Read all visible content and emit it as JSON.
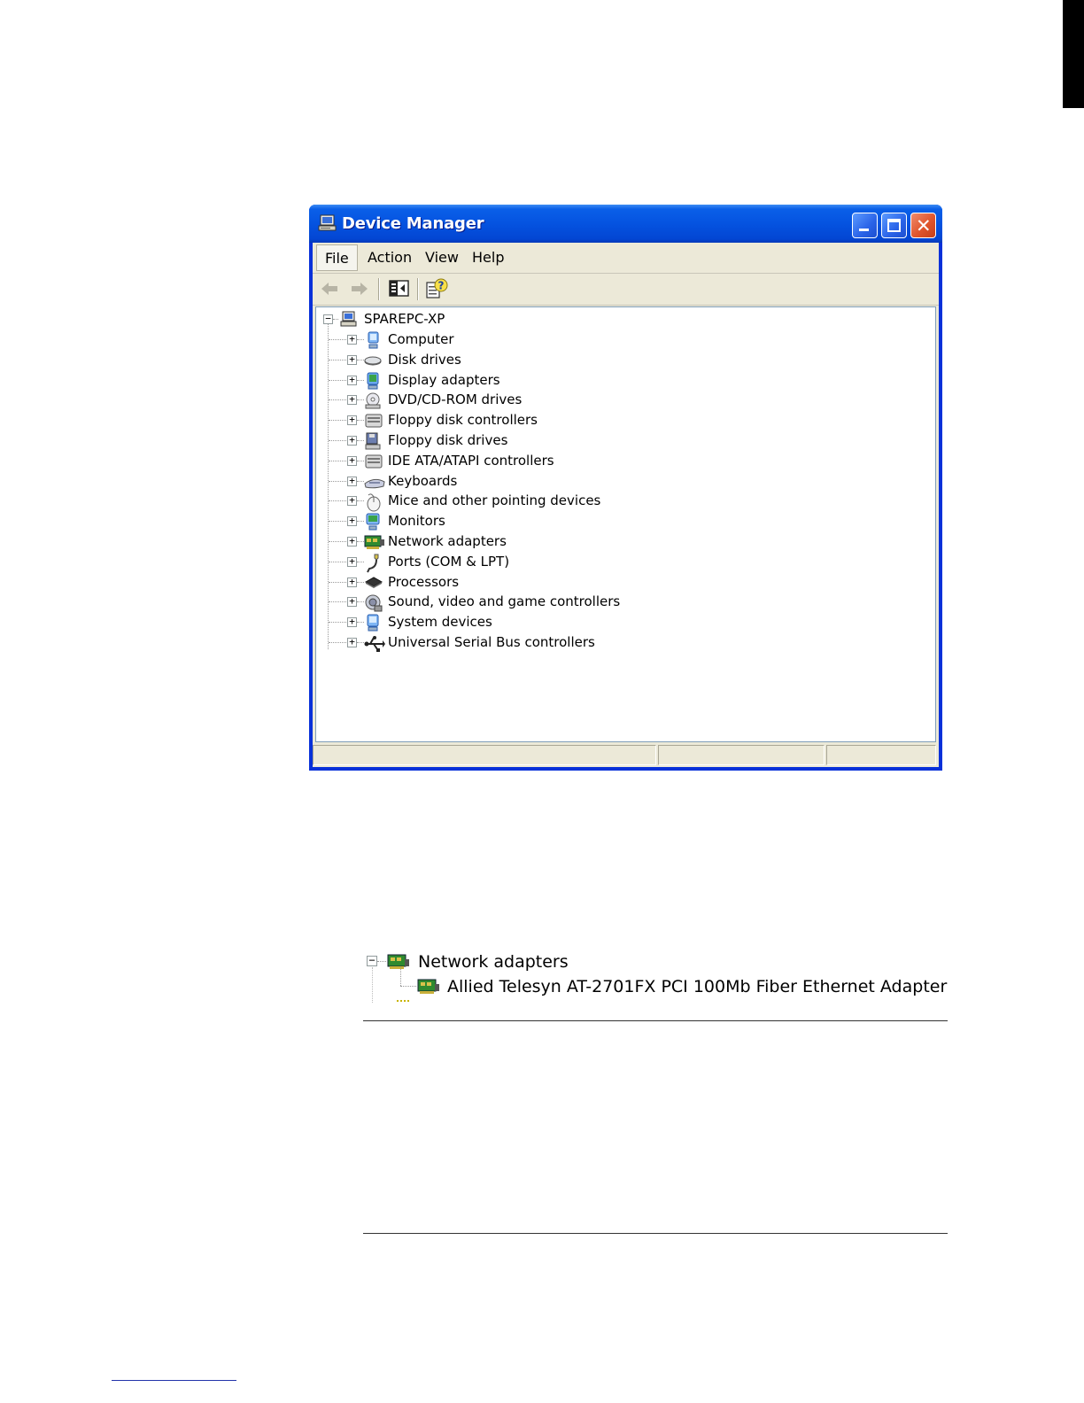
{
  "window": {
    "title": "Device Manager",
    "title_icon": "computer-icon",
    "caption_buttons": [
      "minimize",
      "maximize",
      "close"
    ]
  },
  "menu": [
    {
      "label": "File",
      "active": true
    },
    {
      "label": "Action"
    },
    {
      "label": "View"
    },
    {
      "label": "Help"
    }
  ],
  "toolbar": {
    "buttons": [
      "back-arrow-icon",
      "forward-arrow-icon",
      "show-hide-console-tree-icon",
      "properties-help-icon"
    ]
  },
  "tree": {
    "root": {
      "label": "SPAREPC-XP",
      "icon": "computer-icon",
      "expanded": true
    },
    "children": [
      {
        "label": "Computer",
        "icon": "computer-monitor-icon"
      },
      {
        "label": "Disk drives",
        "icon": "disk-drive-icon"
      },
      {
        "label": "Display adapters",
        "icon": "display-adapter-icon"
      },
      {
        "label": "DVD/CD-ROM drives",
        "icon": "cd-rom-icon"
      },
      {
        "label": "Floppy disk controllers",
        "icon": "controller-icon"
      },
      {
        "label": "Floppy disk drives",
        "icon": "floppy-drive-icon"
      },
      {
        "label": "IDE ATA/ATAPI controllers",
        "icon": "controller-icon"
      },
      {
        "label": "Keyboards",
        "icon": "keyboard-icon"
      },
      {
        "label": "Mice and other pointing devices",
        "icon": "mouse-icon"
      },
      {
        "label": "Monitors",
        "icon": "monitor-icon"
      },
      {
        "label": "Network adapters",
        "icon": "network-adapter-icon"
      },
      {
        "label": "Ports (COM & LPT)",
        "icon": "port-icon"
      },
      {
        "label": "Processors",
        "icon": "processor-icon"
      },
      {
        "label": "Sound, video and game controllers",
        "icon": "sound-icon"
      },
      {
        "label": "System devices",
        "icon": "system-devices-icon"
      },
      {
        "label": "Universal Serial Bus controllers",
        "icon": "usb-icon"
      }
    ]
  },
  "detail": {
    "parent_label": "Network adapters",
    "child_label": "Allied Telesyn AT-2701FX PCI 100Mb Fiber Ethernet Adapter"
  },
  "colors": {
    "titlebar": "#0553e0",
    "window_face": "#ece9d8",
    "close_button": "#e0552c"
  }
}
